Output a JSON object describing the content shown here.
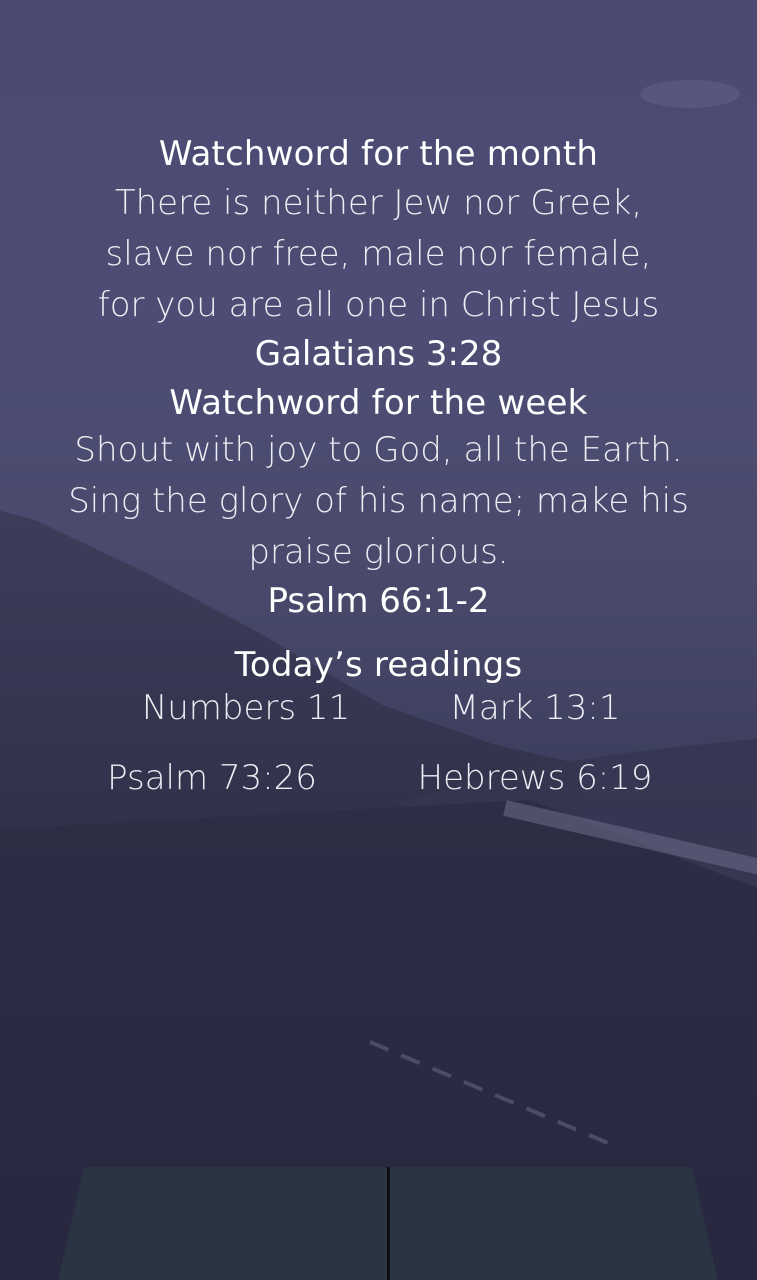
{
  "month": {
    "heading": "Watchword for the month",
    "verse_lines": [
      "There is neither Jew nor Greek,",
      "slave nor free, male nor female,",
      "for you are all one in Christ Jesus"
    ],
    "reference": "Galatians 3:28"
  },
  "week": {
    "heading": "Watchword for the week",
    "verse_lines": [
      "Shout with joy to God, all the Earth.",
      "Sing the glory of his name; make his",
      "praise glorious."
    ],
    "reference": "Psalm 66:1-2"
  },
  "readings": {
    "heading": "Today’s readings",
    "items": [
      "Numbers 11",
      "Mark 13:1",
      "Psalm 73:26",
      "Hebrews 6:19"
    ]
  },
  "colors": {
    "overlay": "#4a4a72",
    "bottom_bar": "#2b3442",
    "text": "#ffffff"
  }
}
